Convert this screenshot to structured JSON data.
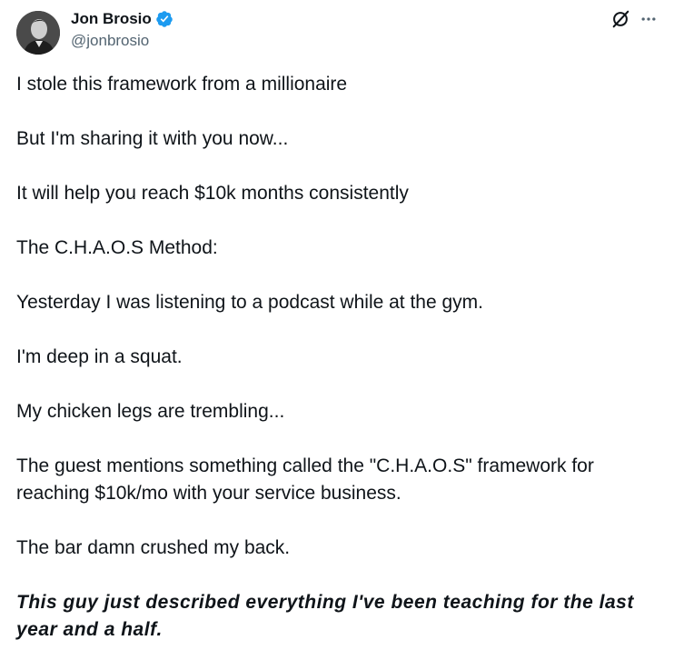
{
  "author": {
    "name": "Jon Brosio",
    "handle": "@jonbrosio",
    "verified": true
  },
  "icons": {
    "avatar": "profile-photo",
    "verified": "verified-badge-icon",
    "grok": "grok-icon",
    "more": "more-options-icon"
  },
  "colors": {
    "text": "#0f1419",
    "muted": "#536471",
    "verified": "#1d9bf0"
  },
  "tweet": {
    "paragraphs": [
      "I stole this framework from a millionaire",
      "But I'm sharing it with you now...",
      "It will help you reach $10k months consistently",
      "The C.H.A.O.S Method:",
      "Yesterday I was listening to a podcast while at the gym.",
      "I'm deep in a squat.",
      "My chicken legs are trembling...",
      "The guest mentions something called the \"C.H.A.O.S\" framework for reaching $10k/mo with your service business.",
      "The bar damn crushed my back.",
      "This guy just described everything I've been teaching for the last year and a half."
    ]
  }
}
